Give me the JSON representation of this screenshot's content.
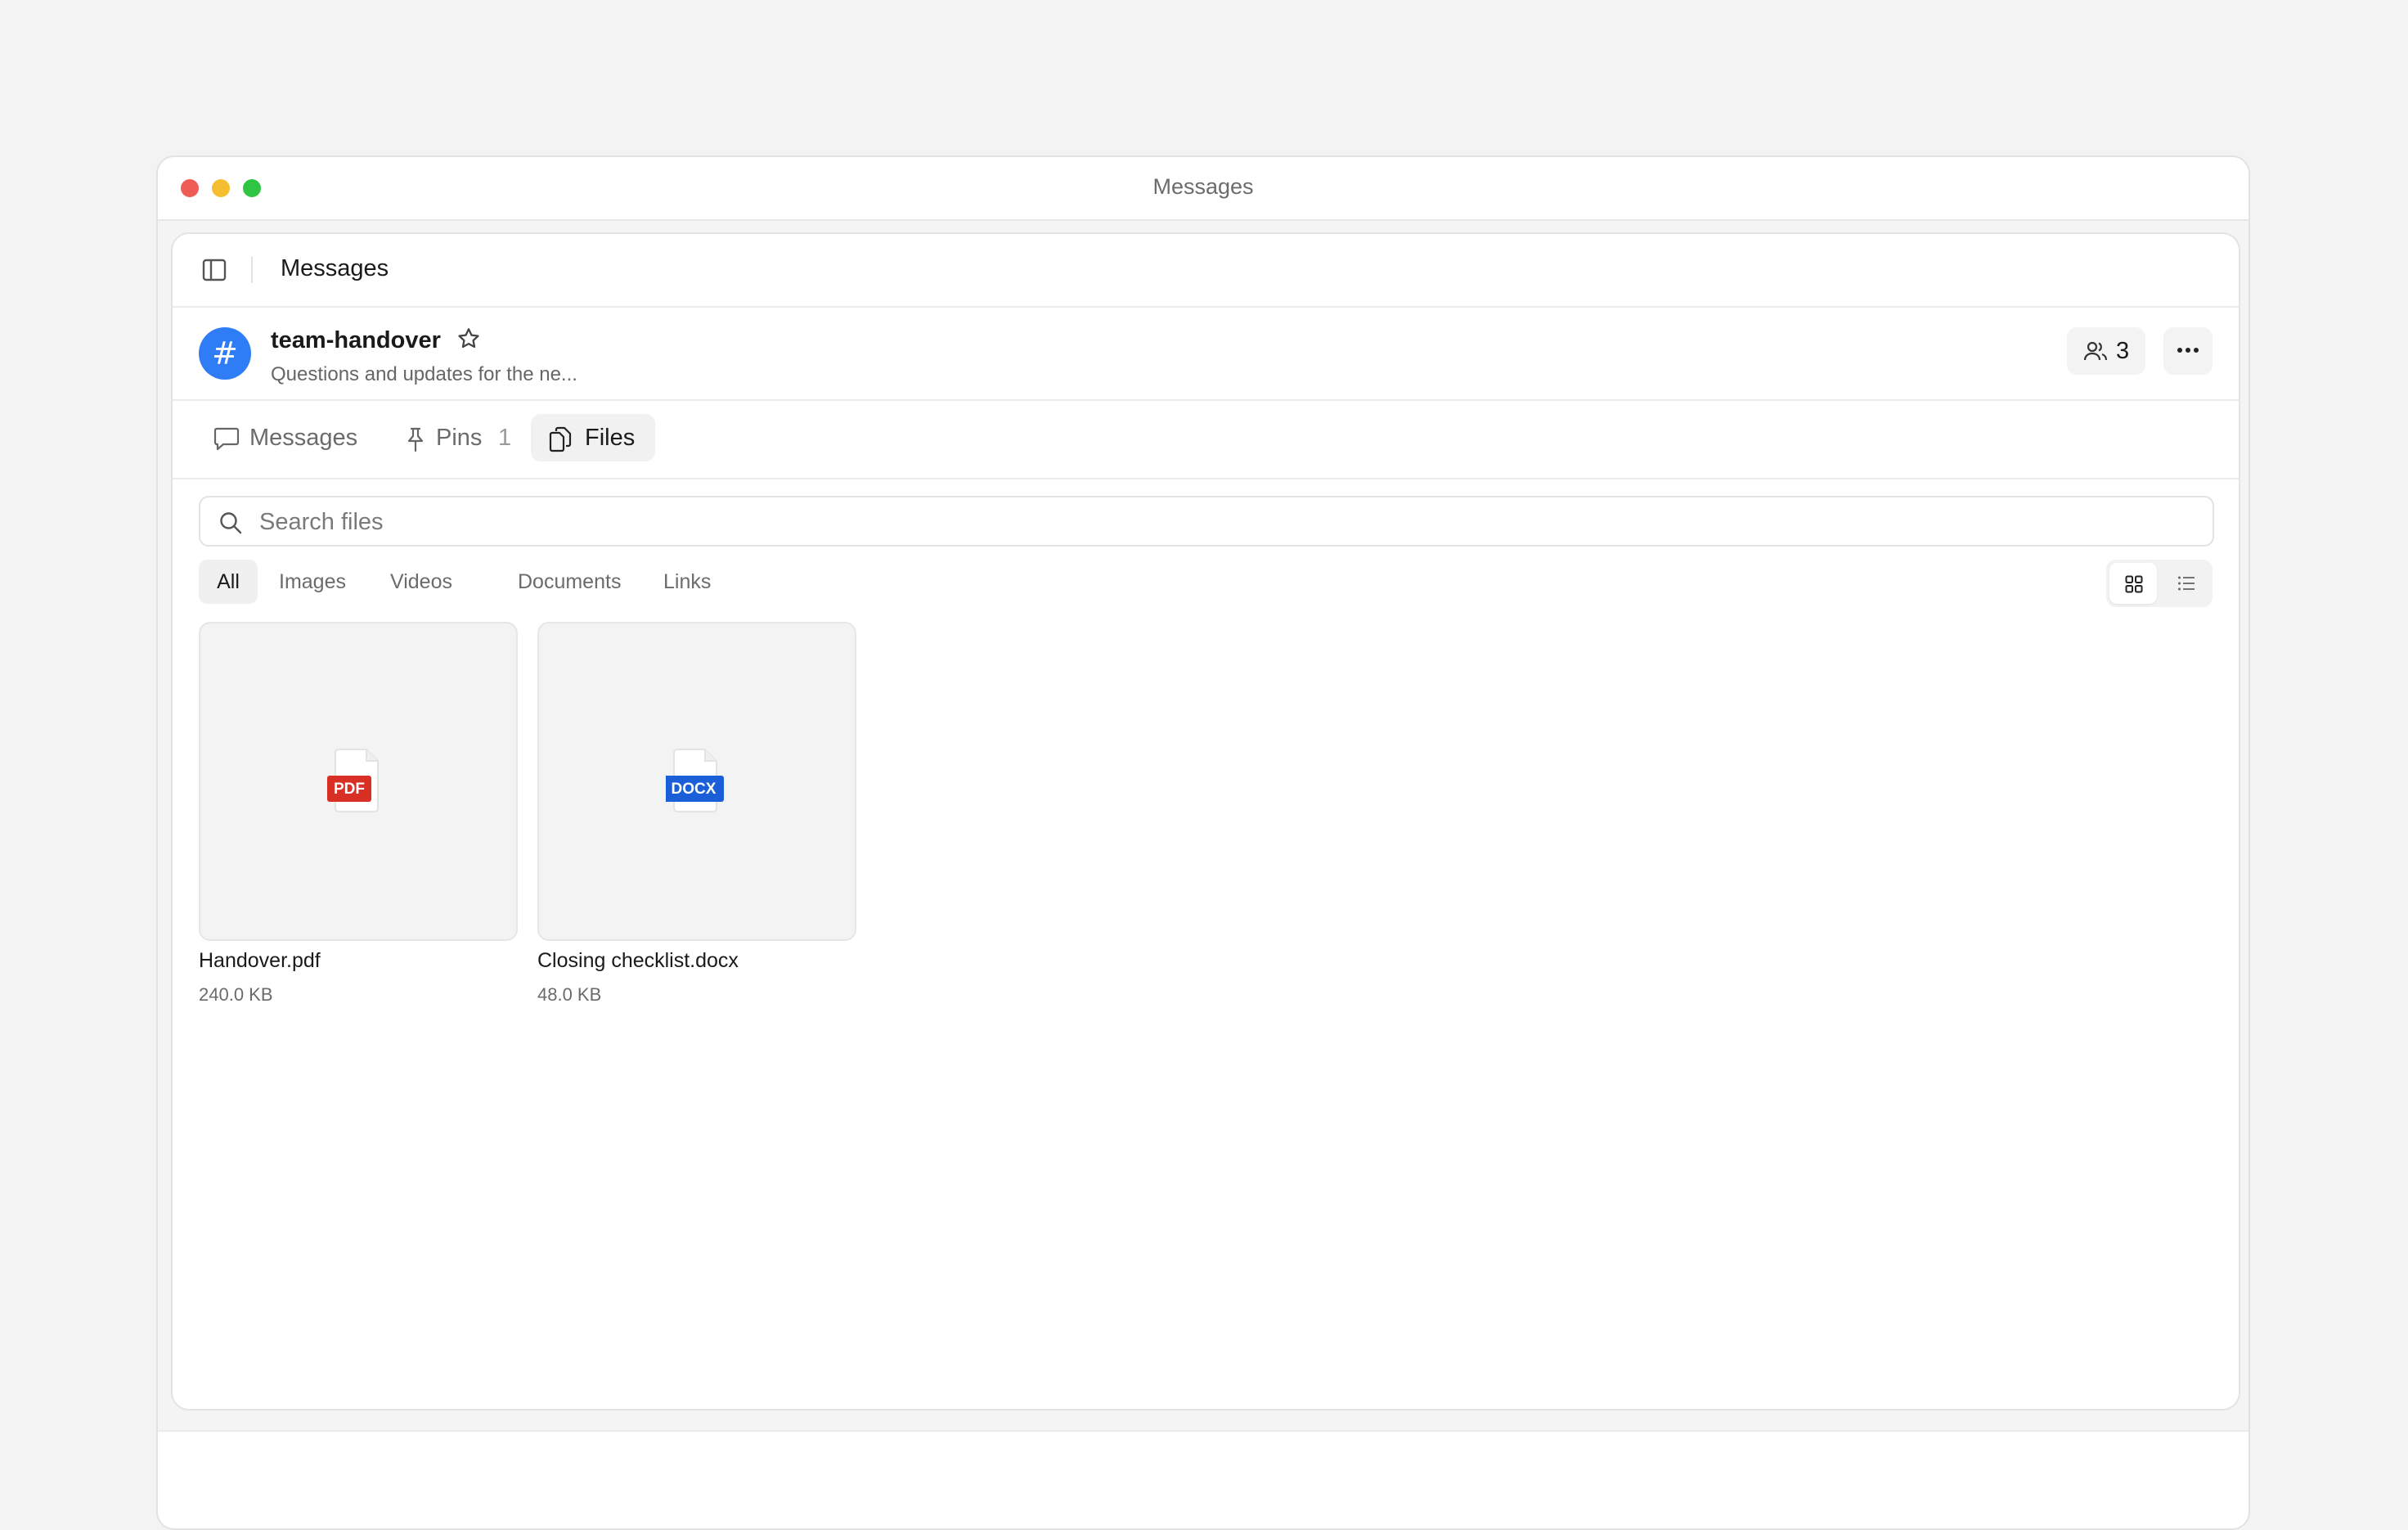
{
  "window": {
    "title": "Messages"
  },
  "topbar": {
    "title": "Messages"
  },
  "channel": {
    "avatar_glyph": "#",
    "name": "team-handover",
    "description": "Questions and updates for the ne...",
    "members_count": "3",
    "accent_color": "#2f7df6"
  },
  "tabs": {
    "messages": "Messages",
    "pins": "Pins",
    "pins_count": "1",
    "files": "Files",
    "active": "Files"
  },
  "search": {
    "placeholder": "Search files",
    "value": ""
  },
  "filters": {
    "items": [
      "All",
      "Images",
      "Videos",
      "Documents",
      "Links"
    ],
    "active": "All"
  },
  "view_mode": "grid",
  "files": [
    {
      "name": "Handover.pdf",
      "size": "240.0 KB",
      "badge": "PDF",
      "badge_color": "#d93025"
    },
    {
      "name": "Closing checklist.docx",
      "size": "48.0 KB",
      "badge": "DOCX",
      "badge_color": "#1a5fd8"
    }
  ]
}
